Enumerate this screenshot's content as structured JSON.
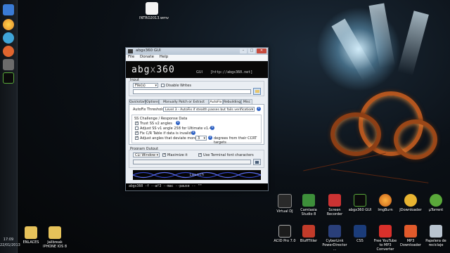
{
  "desktop": {
    "top_icon": {
      "label": "INTRO2013.wmv"
    },
    "bottom_left_icons": [
      {
        "label": "ENLACES"
      },
      {
        "label": "Jailbreak IPHONE IOS 8"
      }
    ],
    "right_icons_row1": [
      {
        "label": "Virtual DJ"
      },
      {
        "label": "Camtasia Studio 8"
      },
      {
        "label": "Screen Recorder"
      },
      {
        "label": "abgx360 GUI"
      },
      {
        "label": "ImgBurn"
      },
      {
        "label": "JDownloader"
      },
      {
        "label": "µTorrent"
      }
    ],
    "right_icons_row2": [
      {
        "label": "ACID Pro 7.0"
      },
      {
        "label": "BluffTitler"
      },
      {
        "label": "CyberLink PowerDirector ..."
      },
      {
        "label": "CS5"
      },
      {
        "label": "Free YouTube to MP3 Converter"
      },
      {
        "label": "MP3 Downloader"
      },
      {
        "label": "Papelera de reciclaje"
      }
    ]
  },
  "taskbar": {
    "time": "17:09",
    "date": "22/01/2013",
    "colors": [
      "#3a7bd5",
      "#e38b2c",
      "#3fa5d8",
      "#e0652e",
      "#6b6b6b",
      "#5aa93a"
    ]
  },
  "window": {
    "title": "abgx360 GUI",
    "menu": [
      "File",
      "Donate",
      "Help"
    ],
    "banner": {
      "logo_a": "abg",
      "logo_b": "x",
      "logo_c": "360",
      "version": "GUI",
      "url": "[http://abgx360.net]"
    },
    "input": {
      "section_label": "Input",
      "type_value": "File(s)",
      "disable_writes_label": "Disable Writes",
      "path_value": ""
    },
    "tabs": [
      "Quickstart",
      "Options",
      "Manually Patch or Extract Files",
      "AutoFix",
      "Rebuilding",
      "Misc"
    ],
    "active_tab": "AutoFix",
    "autofix": {
      "threshold_label": "AutoFix Threshold",
      "threshold_value": "Level 3 - AutoFix if stealth passes but fails verification",
      "ss_section": "SS Challenge / Response Data",
      "options": [
        {
          "label": "Trust SS v2 angles",
          "checked": true
        },
        {
          "label": "Adjust SS v1 angle 258 for Ultimate v1.4",
          "checked": false
        },
        {
          "label": "Fix C/R Table if data is invalid",
          "checked": true
        },
        {
          "label": "Adjust angles that deviate more than",
          "checked": true
        }
      ],
      "deviation_value": "3",
      "deviation_suffix": "degrees from their CCRT targets"
    },
    "output": {
      "section_label": "Program Output",
      "mode_value": "CLI Window",
      "maximize_label": "Maximize it",
      "maximize_checked": true,
      "terminal_font_label": "Use Terminal font characters",
      "terminal_font_checked": true
    },
    "launch_label": "Launch",
    "command": "abgx360 -f --af3 --mac --pause -- \"\""
  }
}
